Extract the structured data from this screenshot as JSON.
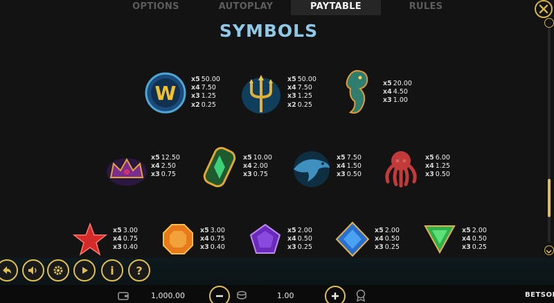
{
  "tabs": [
    {
      "label": "OPTIONS"
    },
    {
      "label": "AUTOPLAY"
    },
    {
      "label": "PAYTABLE"
    },
    {
      "label": "RULES"
    }
  ],
  "active_tab": "PAYTABLE",
  "section_title": "SYMBOLS",
  "symbols": [
    {
      "icon": "wild-w-icon",
      "pays": [
        {
          "mult": "x5",
          "value": "50.00"
        },
        {
          "mult": "x4",
          "value": "7.50"
        },
        {
          "mult": "x3",
          "value": "1.25"
        },
        {
          "mult": "x2",
          "value": "0.25"
        }
      ]
    },
    {
      "icon": "trident-icon",
      "pays": [
        {
          "mult": "x5",
          "value": "50.00"
        },
        {
          "mult": "x4",
          "value": "7.50"
        },
        {
          "mult": "x3",
          "value": "1.25"
        },
        {
          "mult": "x2",
          "value": "0.25"
        }
      ]
    },
    {
      "icon": "seahorse-icon",
      "pays": [
        {
          "mult": "x5",
          "value": "20.00"
        },
        {
          "mult": "x4",
          "value": "4.50"
        },
        {
          "mult": "x3",
          "value": "1.00"
        }
      ]
    },
    {
      "icon": "crown-icon",
      "pays": [
        {
          "mult": "x5",
          "value": "12.50"
        },
        {
          "mult": "x4",
          "value": "2.50"
        },
        {
          "mult": "x3",
          "value": "0.75"
        }
      ]
    },
    {
      "icon": "emerald-scroll-icon",
      "pays": [
        {
          "mult": "x5",
          "value": "10.00"
        },
        {
          "mult": "x4",
          "value": "2.00"
        },
        {
          "mult": "x3",
          "value": "0.75"
        }
      ]
    },
    {
      "icon": "dolphin-icon",
      "pays": [
        {
          "mult": "x5",
          "value": "7.50"
        },
        {
          "mult": "x4",
          "value": "1.50"
        },
        {
          "mult": "x3",
          "value": "0.50"
        }
      ]
    },
    {
      "icon": "octopus-icon",
      "pays": [
        {
          "mult": "x5",
          "value": "6.00"
        },
        {
          "mult": "x4",
          "value": "1.25"
        },
        {
          "mult": "x3",
          "value": "0.50"
        }
      ]
    },
    {
      "icon": "red-star-gem-icon",
      "pays": [
        {
          "mult": "x5",
          "value": "3.00"
        },
        {
          "mult": "x4",
          "value": "0.75"
        },
        {
          "mult": "x3",
          "value": "0.40"
        }
      ]
    },
    {
      "icon": "orange-octagon-gem-icon",
      "pays": [
        {
          "mult": "x5",
          "value": "3.00"
        },
        {
          "mult": "x4",
          "value": "0.75"
        },
        {
          "mult": "x3",
          "value": "0.40"
        }
      ]
    },
    {
      "icon": "purple-pentagon-gem-icon",
      "pays": [
        {
          "mult": "x5",
          "value": "2.00"
        },
        {
          "mult": "x4",
          "value": "0.50"
        },
        {
          "mult": "x3",
          "value": "0.25"
        }
      ]
    },
    {
      "icon": "blue-diamond-gem-icon",
      "pays": [
        {
          "mult": "x5",
          "value": "2.00"
        },
        {
          "mult": "x4",
          "value": "0.50"
        },
        {
          "mult": "x3",
          "value": "0.25"
        }
      ]
    },
    {
      "icon": "green-triangle-gem-icon",
      "pays": [
        {
          "mult": "x5",
          "value": "2.00"
        },
        {
          "mult": "x4",
          "value": "0.50"
        },
        {
          "mult": "x3",
          "value": "0.25"
        }
      ]
    }
  ],
  "controls": {
    "info_label": "i",
    "help_label": "?"
  },
  "status": {
    "balance": "1,000.00",
    "bet": "1.00",
    "brand": "BETSOFT"
  },
  "colors": {
    "accent_gold": "#e0c050",
    "title_blue": "#8ec9e8",
    "background": "#131313"
  }
}
